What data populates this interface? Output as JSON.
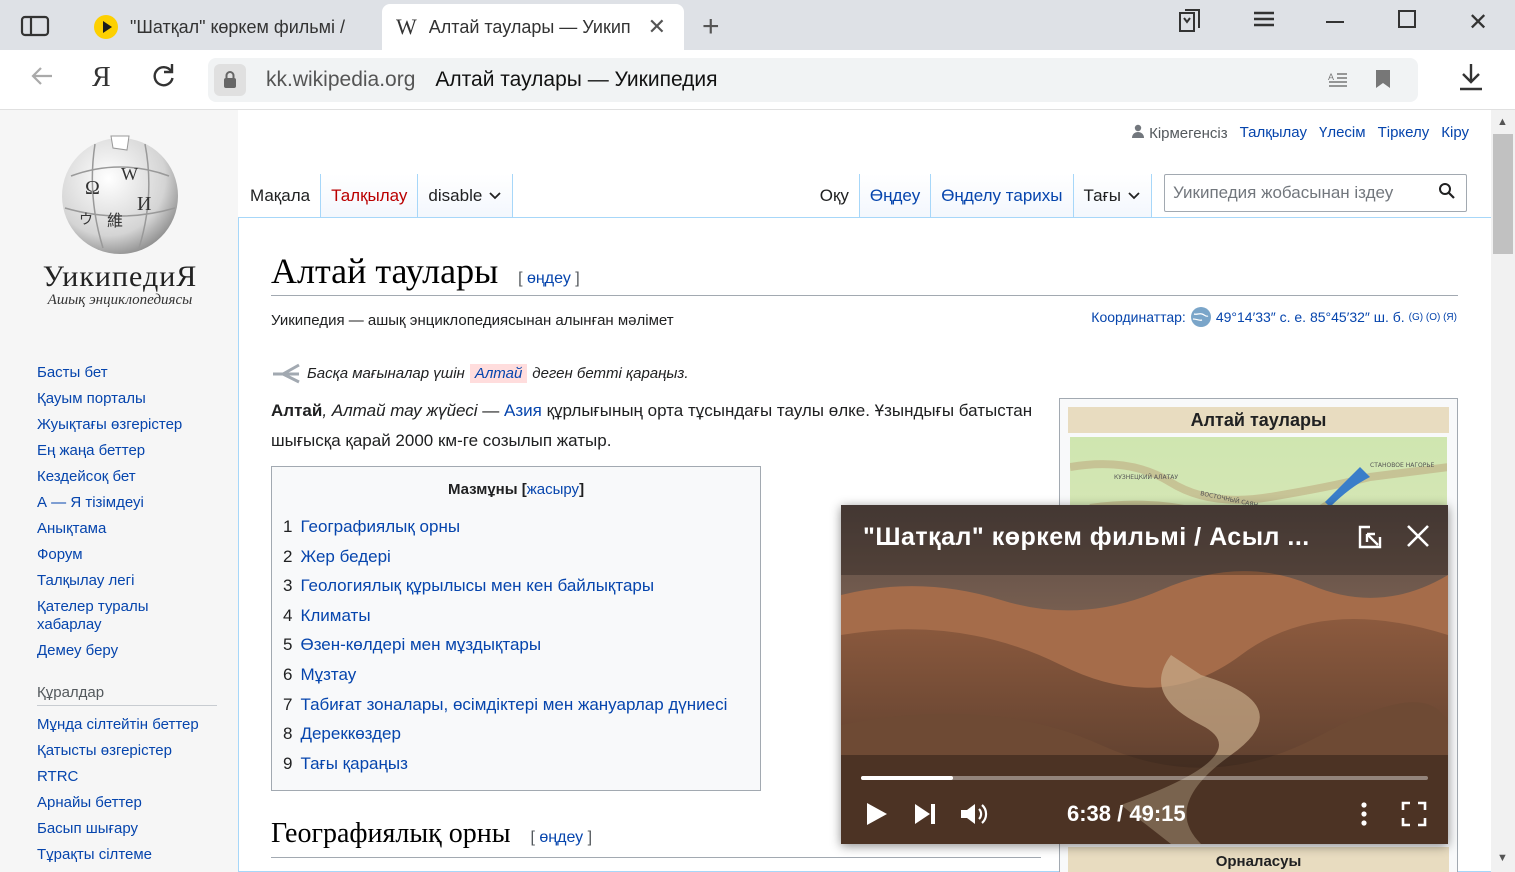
{
  "browser": {
    "tabs": [
      {
        "title": "\"Шатқал\" көркем фильмі /",
        "active": false
      },
      {
        "title": "Алтай таулары — Уикип",
        "active": true
      }
    ],
    "domain": "kk.wikipedia.org",
    "page_title": "Алтай таулары — Уикипедия",
    "yandex_label": "Я"
  },
  "wiki": {
    "wordmark": "УикипедиЯ",
    "tagline": "Ашық энциклопедиясы",
    "nav": [
      "Басты бет",
      "Қауым порталы",
      "Жуықтағы өзгерістер",
      "Ең жаңа беттер",
      "Кездейсоқ бет",
      "А — Я тізімдеуі",
      "Анықтама",
      "Форум",
      "Талқылау легі",
      "Қателер туралы хабарлау",
      "Демеу беру"
    ],
    "tools_heading": "Құралдар",
    "tools": [
      "Мұнда сілтейтін беттер",
      "Қатысты өзгерістер",
      "RTRC",
      "Арнайы беттер",
      "Басып шығару",
      "Тұрақты сілтеме"
    ],
    "personal": {
      "anon": "Кірмегенсіз",
      "links": [
        "Талқылау",
        "Үлесім",
        "Тіркелу",
        "Кіру"
      ]
    },
    "tabs_left": [
      "Мақала",
      "Талқылау",
      "disable"
    ],
    "tabs_right": [
      "Оқу",
      "Өңдеу",
      "Өңделу тарихы",
      "Тағы"
    ],
    "search_placeholder": "Уикипедия жобасынан іздеу",
    "title": "Алтай таулары",
    "edit": "өңдеу",
    "coords_label": "Координаттар:",
    "coords_value": "49°14′33″ с. е. 85°45′32″ ш. б.",
    "coords_sup": "(G) (O) (Я)",
    "site_sub": "Уикипедия — ашық энциклопедиясынан алынған мәлімет",
    "hatnote_before": "Басқа мағыналар үшін",
    "hatnote_link": "Алтай",
    "hatnote_after": "деген бетті қараңыз.",
    "lead_bold": "Алтай",
    "lead_italic": ", Алтай тау жүйесі",
    "lead_dash": " — ",
    "lead_link": "Азия",
    "lead_rest": " құрлығының орта тұсындағы таулы өлке. Ұзындығы батыстан шығысқа қарай 2000 км-ге созылып жатыр.",
    "toc_title": "Мазмұны",
    "toc_hide": "жасыру",
    "toc": [
      {
        "n": "1",
        "t": "Географиялық орны"
      },
      {
        "n": "2",
        "t": "Жер бедері"
      },
      {
        "n": "3",
        "t": "Геологиялық құрылысы мен кен байлықтары"
      },
      {
        "n": "4",
        "t": "Климаты"
      },
      {
        "n": "5",
        "t": "Өзен-көлдері мен мұздықтары"
      },
      {
        "n": "6",
        "t": "Мұзтау"
      },
      {
        "n": "7",
        "t": "Табиғат зоналары, өсімдіктері мен жануарлар дүниесі"
      },
      {
        "n": "8",
        "t": "Дереккөздер"
      },
      {
        "n": "9",
        "t": "Тағы қараңыз"
      }
    ],
    "section1": "Географиялық орны",
    "infobox_title": "Алтай таулары",
    "infobox_caption": "Орналасуы",
    "map_labels": [
      "КУЗНЕЦКИЙ АЛАТАУ",
      "ВОСТОЧНЫЙ САЯН",
      "СТАНОВОЕ НАГОРЬЕ"
    ]
  },
  "video": {
    "title": "\"Шатқал\" көркем фильмі / Асыл ...",
    "time": "6:38 / 49:15",
    "progress": 0.162
  }
}
